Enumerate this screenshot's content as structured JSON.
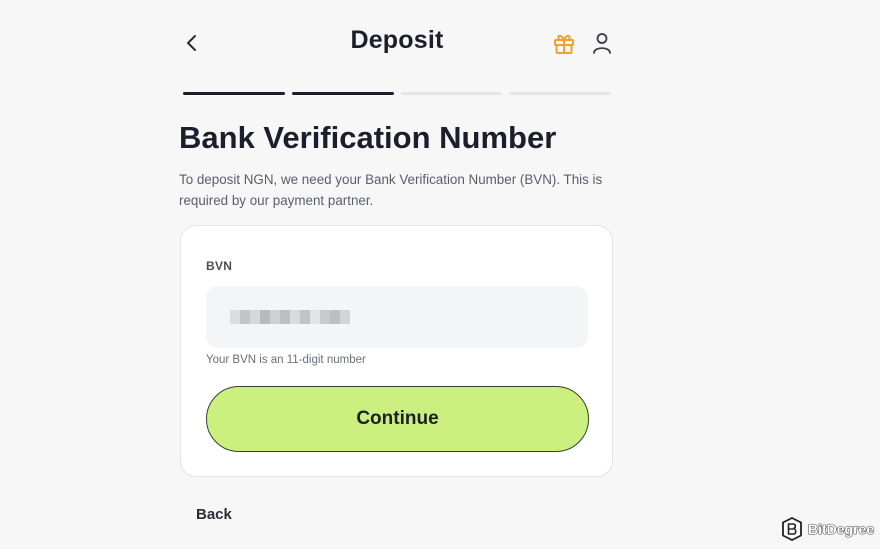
{
  "header": {
    "title": "Deposit",
    "back_icon": "chevron-left-icon",
    "gift_icon": "gift-icon",
    "profile_icon": "user-icon",
    "accent_color": "#f0a030"
  },
  "stepper": {
    "total_steps": 4,
    "completed_steps": 2
  },
  "main": {
    "heading": "Bank Verification Number",
    "description": "To deposit NGN, we need your Bank Verification Number (BVN). This is required by our payment partner."
  },
  "form": {
    "bvn_label": "BVN",
    "bvn_value_masked": true,
    "hint": "Your BVN is an 11-digit number",
    "continue_label": "Continue",
    "continue_color": "#ccf07f"
  },
  "footer": {
    "back_label": "Back"
  },
  "watermark": {
    "text": "BitDegree"
  }
}
